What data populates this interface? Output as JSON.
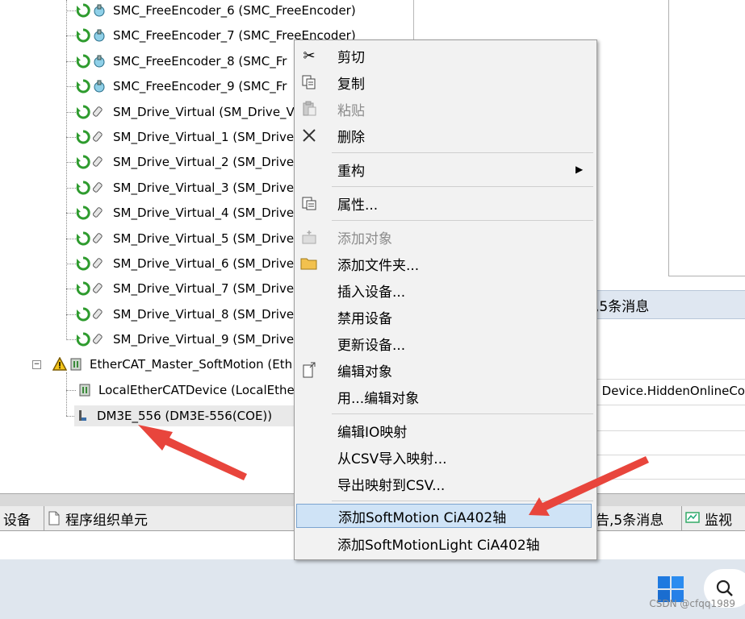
{
  "tree": {
    "axes": [
      "SMC_FreeEncoder_6 (SMC_FreeEncoder)",
      "SMC_FreeEncoder_7 (SMC_FreeEncoder)",
      "SMC_FreeEncoder_8 (SMC_Fr",
      "SMC_FreeEncoder_9 (SMC_Fr",
      "SM_Drive_Virtual (SM_Drive_V",
      "SM_Drive_Virtual_1 (SM_Drive",
      "SM_Drive_Virtual_2 (SM_Drive",
      "SM_Drive_Virtual_3 (SM_Drive",
      "SM_Drive_Virtual_4 (SM_Drive",
      "SM_Drive_Virtual_5 (SM_Drive",
      "SM_Drive_Virtual_6 (SM_Drive",
      "SM_Drive_Virtual_7 (SM_Drive",
      "SM_Drive_Virtual_8 (SM_Drive",
      "SM_Drive_Virtual_9 (SM_Drive"
    ],
    "master": "EtherCAT_Master_SoftMotion (Eth",
    "local_device": "LocalEtherCATDevice (LocalEther",
    "dm3e": "DM3E_556 (DM3E-556(COE))"
  },
  "right": {
    "messages": ",5条消息",
    "online_config": "Device.HiddenOnlineCon",
    "online_prefix": "("
  },
  "tabs": {
    "devices": "设备",
    "pou": "程序组织单元",
    "warnings": "告,5条消息",
    "monitor": "监视"
  },
  "menu": {
    "cut": "剪切",
    "copy": "复制",
    "paste": "粘贴",
    "delete": "删除",
    "refactor": "重构",
    "properties": "属性...",
    "add_object": "添加对象",
    "add_folder": "添加文件夹...",
    "insert_device": "插入设备...",
    "disable_device": "禁用设备",
    "update_device": "更新设备...",
    "edit_object": "编辑对象",
    "edit_object_with": "用...编辑对象",
    "edit_io": "编辑IO映射",
    "import_csv": "从CSV导入映射...",
    "export_csv": "导出映射到CSV...",
    "add_softmotion": "添加SoftMotion CiA402轴",
    "add_softmotion_light": "添加SoftMotionLight CiA402轴"
  },
  "watermark": "CSDN @cfqq1989",
  "colors": {
    "arrow": "#e8453c",
    "highlight": "#cfe3f6",
    "menu_bg": "#f2f2f2"
  }
}
